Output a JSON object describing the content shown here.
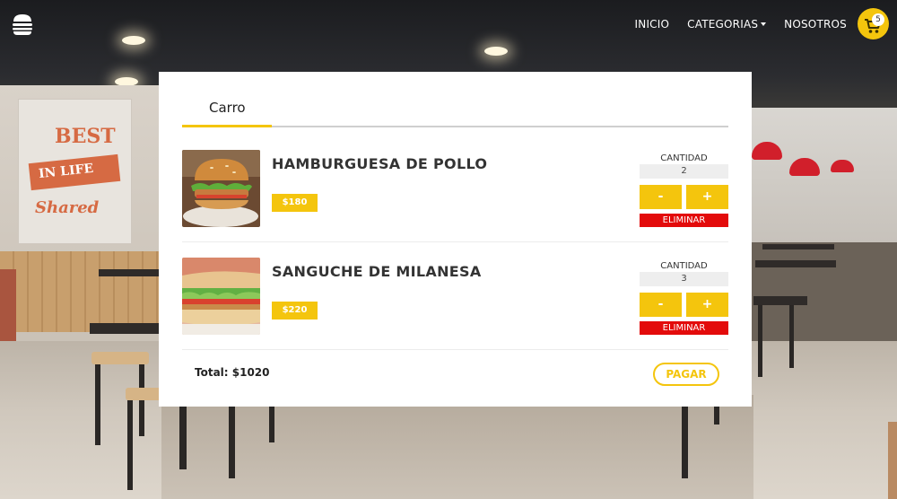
{
  "nav": {
    "logo_icon": "burger-icon",
    "links": [
      "INICIO",
      "CATEGORIAS",
      "NOSOTROS"
    ],
    "cart_icon": "cart-icon",
    "cart_count": "5"
  },
  "background": {
    "mural_lines": [
      "BEST",
      "IN LIFE",
      "Shared"
    ]
  },
  "cart": {
    "tab_label": "Carro",
    "quantity_label": "CANTIDAD",
    "minus_label": "-",
    "plus_label": "+",
    "delete_label": "ELIMINAR",
    "items": [
      {
        "name": "HAMBURGUESA DE POLLO",
        "price": "$180",
        "quantity": "2",
        "image": "chicken-burger-photo"
      },
      {
        "name": "SANGUCHE DE MILANESA",
        "price": "$220",
        "quantity": "3",
        "image": "milanesa-sandwich-photo"
      }
    ],
    "total": "Total: $1020",
    "pay_label": "PAGAR"
  },
  "colors": {
    "accent": "#f4c50d",
    "danger": "#e30b0b",
    "panel": "#ffffff",
    "text": "#333333"
  }
}
